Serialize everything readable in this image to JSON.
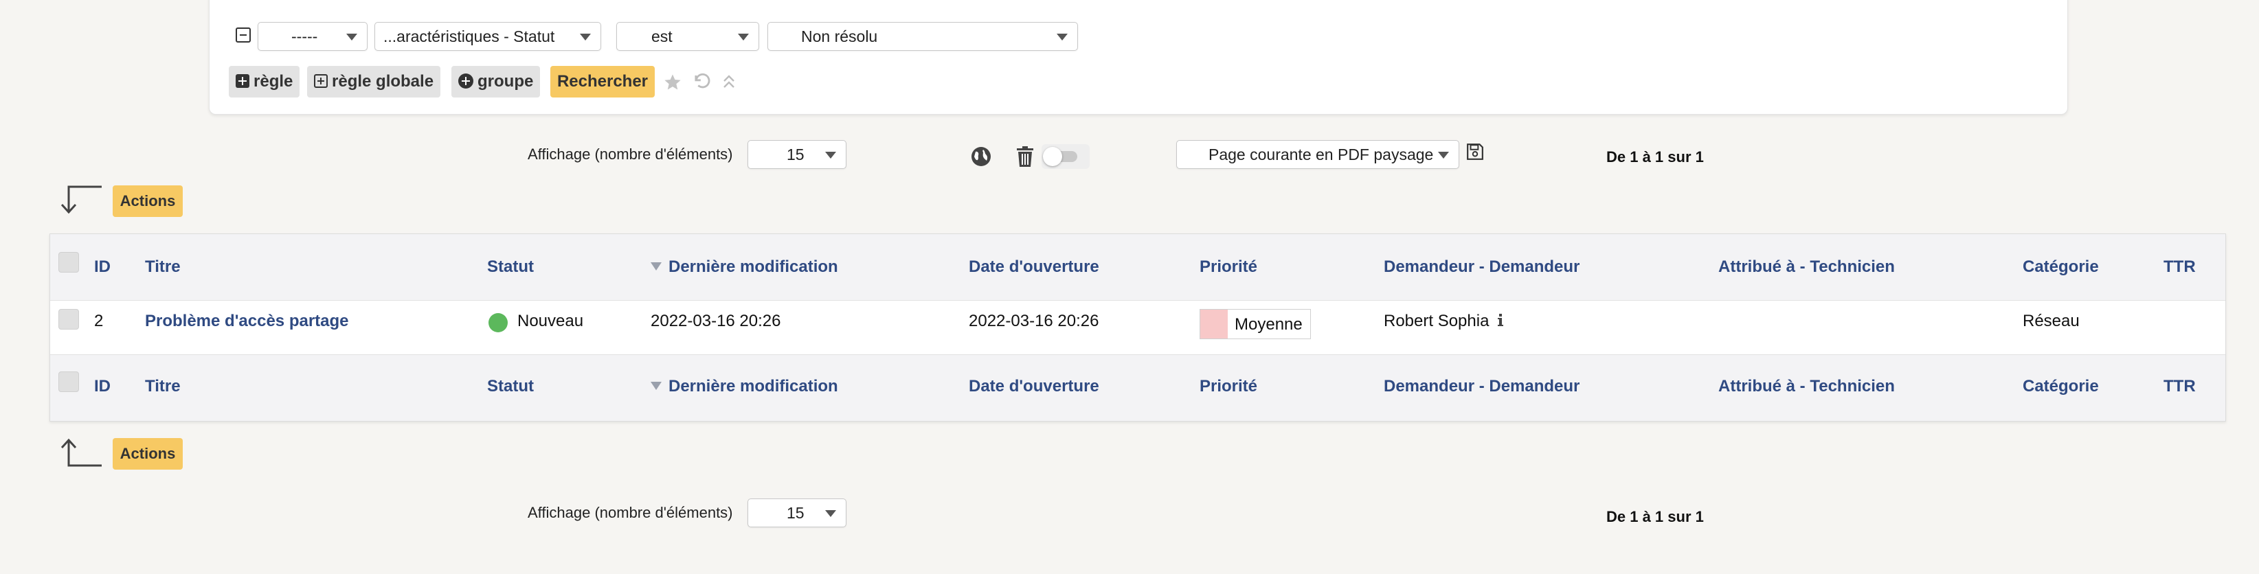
{
  "search": {
    "field1": "-----",
    "field2": "...aractéristiques - Statut",
    "operator": "est",
    "value": "Non résolu",
    "buttons": {
      "rule": "règle",
      "global_rule": "règle globale",
      "group": "groupe",
      "search": "Rechercher"
    }
  },
  "pager_top": {
    "display_label": "Affichage (nombre d'éléments)",
    "display_value": "15",
    "export_option": "Page courante en PDF paysage",
    "range": "De 1 à 1 sur 1"
  },
  "actions_label": "Actions",
  "table": {
    "columns": [
      "ID",
      "Titre",
      "Statut",
      "Dernière modification",
      "Date d'ouverture",
      "Priorité",
      "Demandeur - Demandeur",
      "Attribué à - Technicien",
      "Catégorie",
      "TTR"
    ],
    "rows": [
      {
        "id": "2",
        "title": "Problème d'accès partage",
        "status": "Nouveau",
        "status_color": "#5cb85c",
        "last_modified": "2022-03-16 20:26",
        "opened": "2022-03-16 20:26",
        "priority": "Moyenne",
        "priority_color": "#f8c8c8",
        "requester": "Robert Sophia",
        "technician": "",
        "category": "Réseau",
        "ttr": ""
      }
    ]
  },
  "pager_bottom": {
    "display_label": "Affichage (nombre d'éléments)",
    "display_value": "15",
    "range": "De 1 à 1 sur 1"
  },
  "colors": {
    "accent_yellow": "#f7c963",
    "header_blue": "#2f4a82",
    "background": "#f6f5f2"
  }
}
